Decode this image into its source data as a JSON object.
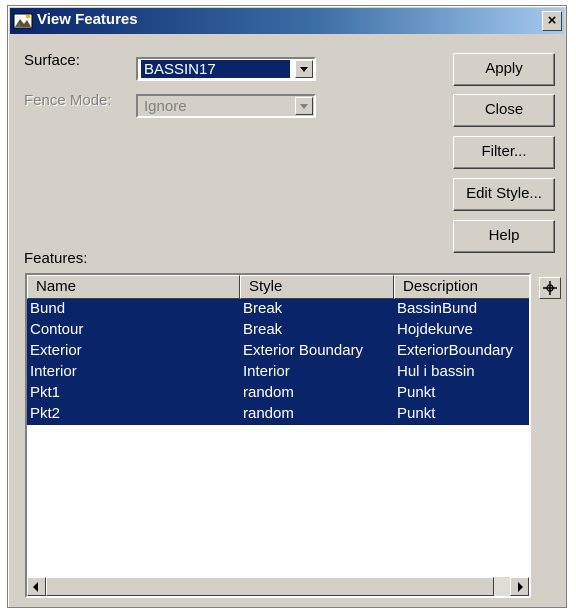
{
  "window": {
    "title": "View Features",
    "close_glyph": "×"
  },
  "form": {
    "surface_label": "Surface:",
    "surface_value": "BASSIN17",
    "fence_label": "Fence Mode:",
    "fence_value": "Ignore",
    "features_label": "Features:"
  },
  "buttons": {
    "apply": "Apply",
    "close": "Close",
    "filter": "Filter...",
    "edit_style": "Edit Style...",
    "help": "Help"
  },
  "table": {
    "columns": [
      "Name",
      "Style",
      "Description"
    ],
    "rows": [
      [
        "Bund",
        "Break",
        "BassinBund"
      ],
      [
        "Contour",
        "Break",
        "Hojdekurve"
      ],
      [
        "Exterior",
        "Exterior Boundary",
        "ExteriorBoundary"
      ],
      [
        "Interior",
        "Interior",
        "Hul i bassin"
      ],
      [
        "Pkt1",
        "random",
        "Punkt"
      ],
      [
        "Pkt2",
        "random",
        "Punkt"
      ]
    ]
  },
  "icons": {
    "window": "view-features-icon",
    "side": "crosshair-icon"
  },
  "colors": {
    "selection": "#0a246a",
    "titlebar_start": "#0a246a",
    "titlebar_end": "#a6caf0",
    "face": "#d4d0c8"
  }
}
